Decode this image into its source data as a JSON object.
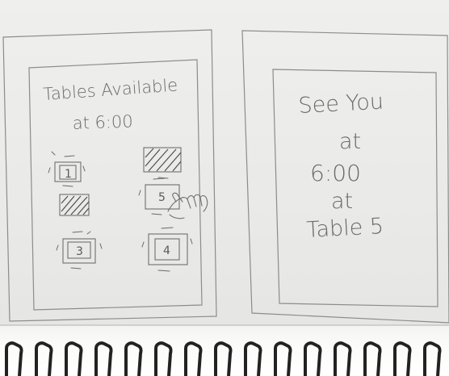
{
  "screen_left": {
    "title_line1": "Tables Available",
    "title_line2": "at 6:00",
    "tables": [
      {
        "id": "table-1",
        "label": "1",
        "state": "available"
      },
      {
        "id": "table-2",
        "label": "",
        "state": "taken"
      },
      {
        "id": "table-3",
        "label": "3",
        "state": "available"
      },
      {
        "id": "table-4",
        "label": "4",
        "state": "available"
      },
      {
        "id": "table-5",
        "label": "5",
        "state": "available"
      },
      {
        "id": "table-6",
        "label": "",
        "state": "taken"
      }
    ]
  },
  "screen_right": {
    "line1": "See You",
    "line2": "at",
    "line3": "6:00",
    "line4": "at",
    "line5": "Table 5"
  },
  "colors": {
    "paper": "#ebebea",
    "pencil": "#6a6a6a",
    "ring": "#222222"
  },
  "icons": [
    "tap-hand-icon",
    "binder-ring-icon"
  ]
}
